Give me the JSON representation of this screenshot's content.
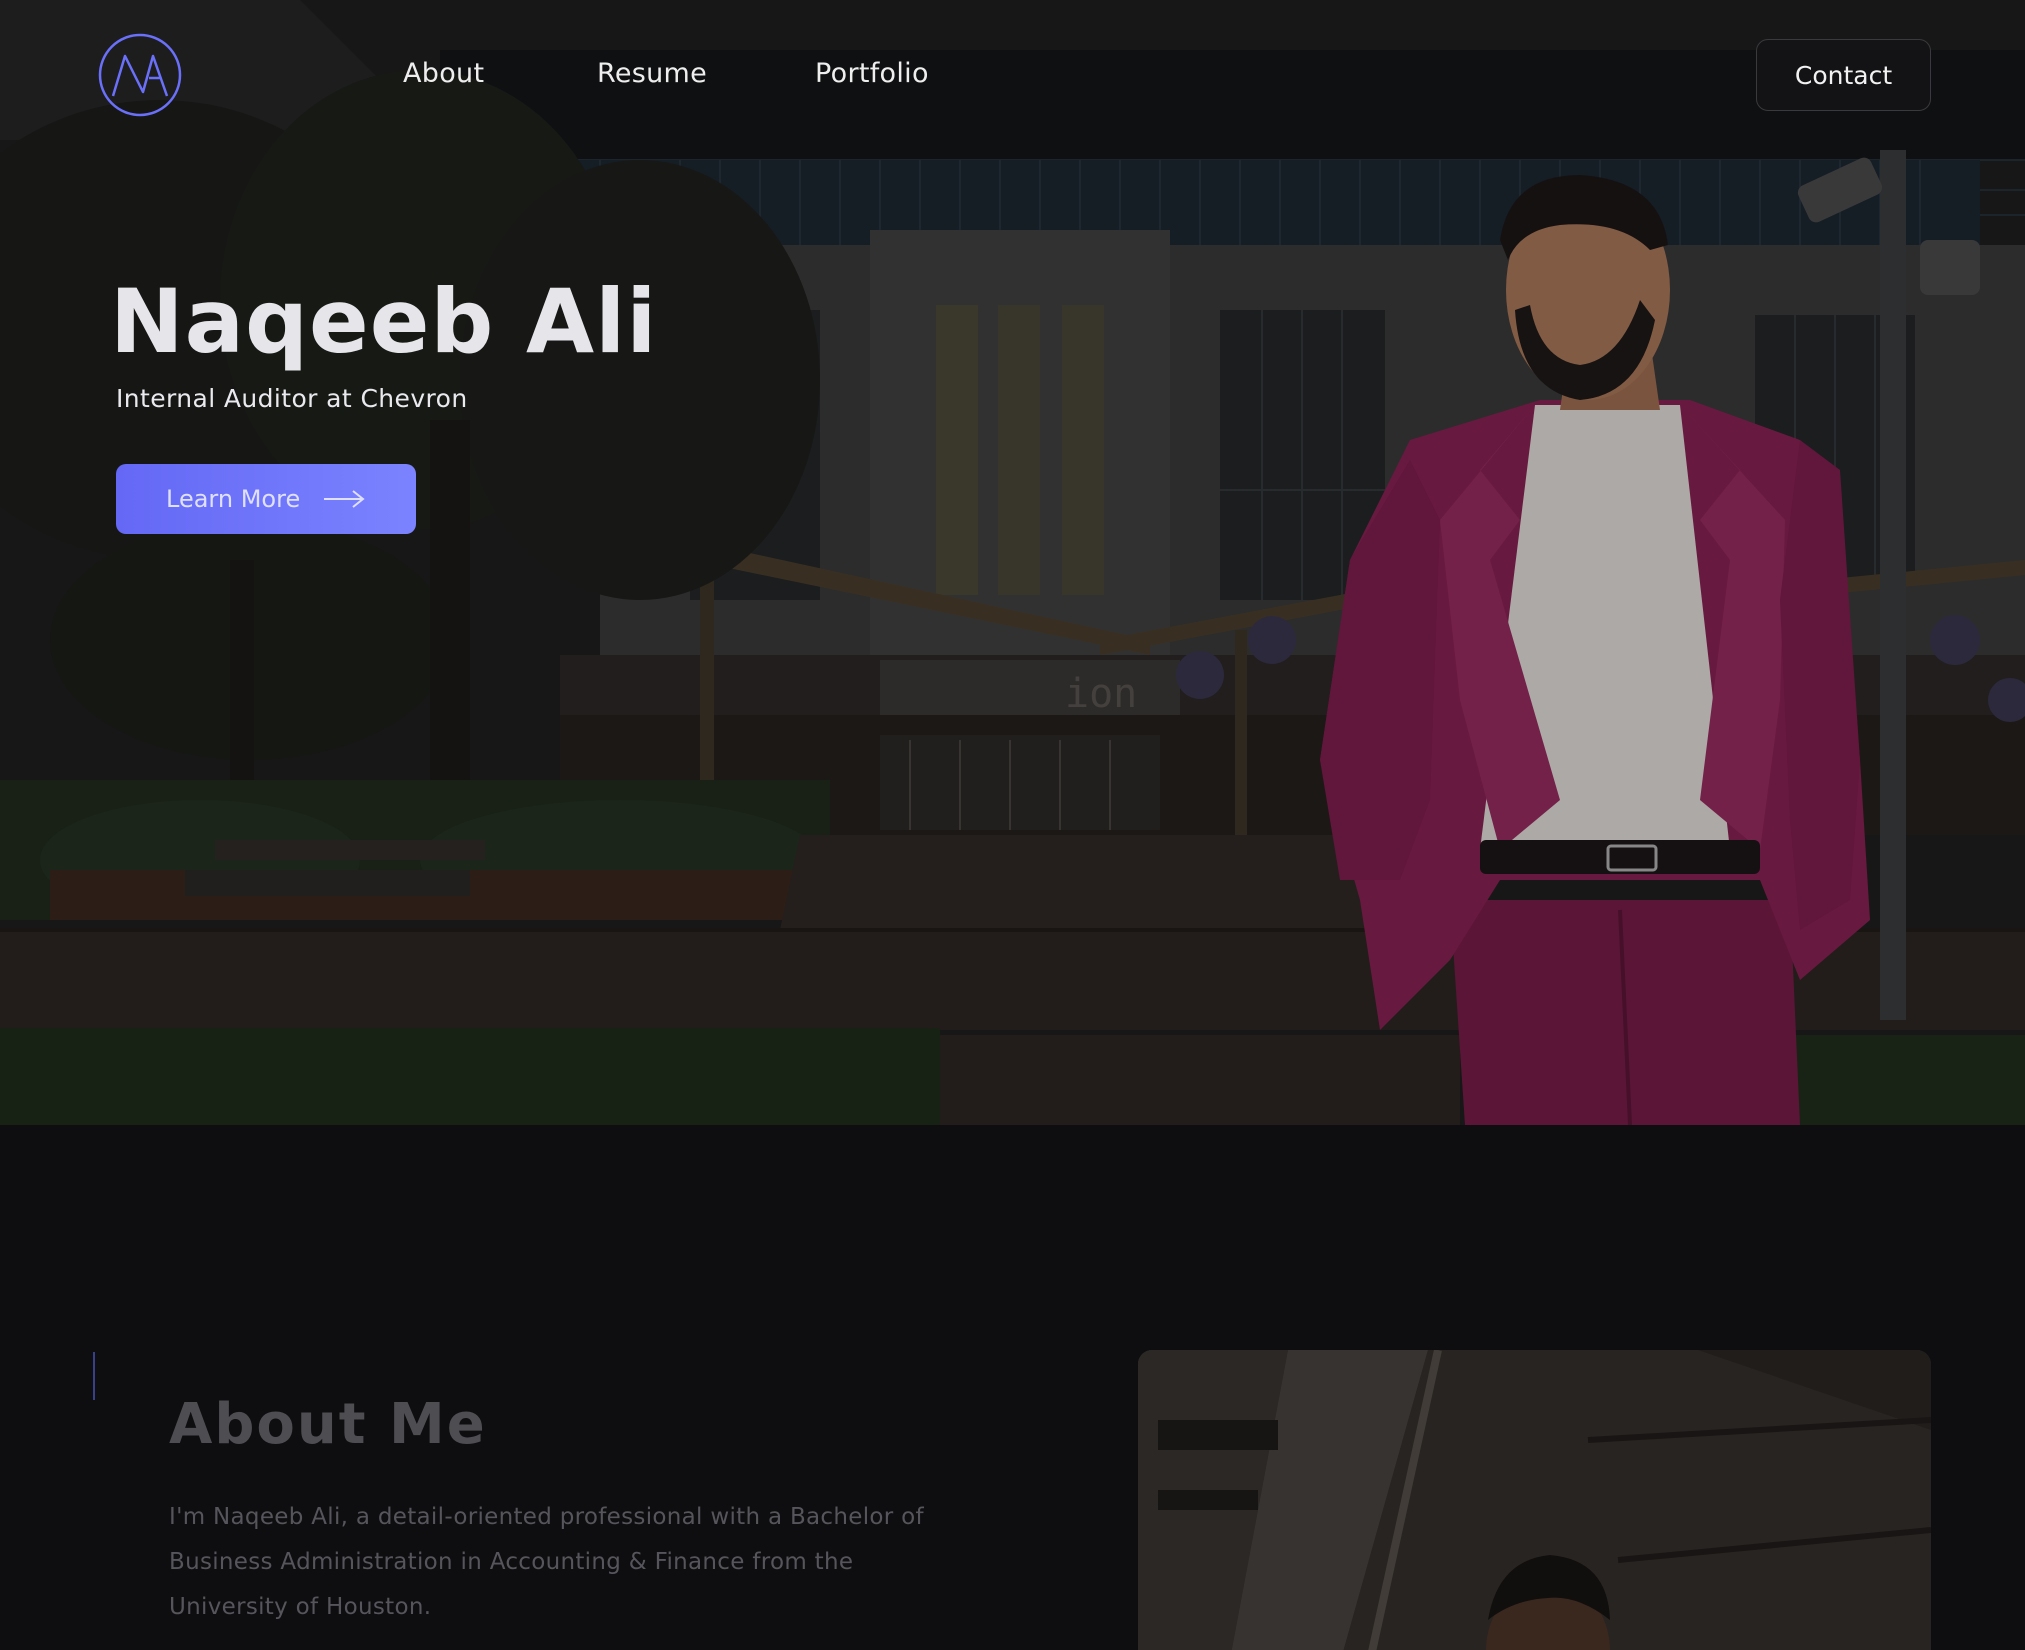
{
  "nav": {
    "logo_text": "NA",
    "items": [
      {
        "label": "About"
      },
      {
        "label": "Resume"
      },
      {
        "label": "Portfolio"
      }
    ],
    "contact_label": "Contact"
  },
  "hero": {
    "name": "Naqeeb Ali",
    "subtitle": "Internal Auditor at Chevron",
    "cta_label": "Learn More",
    "building_sign": "ion"
  },
  "about": {
    "title": "About Me",
    "text": "I'm Naqeeb Ali, a detail-oriented professional with a Bachelor of Business Administration in Accounting & Finance from the University of Houston."
  },
  "colors": {
    "accent": "#6a70fa",
    "suit": "#8a1f52",
    "background": "#0e0e10"
  }
}
